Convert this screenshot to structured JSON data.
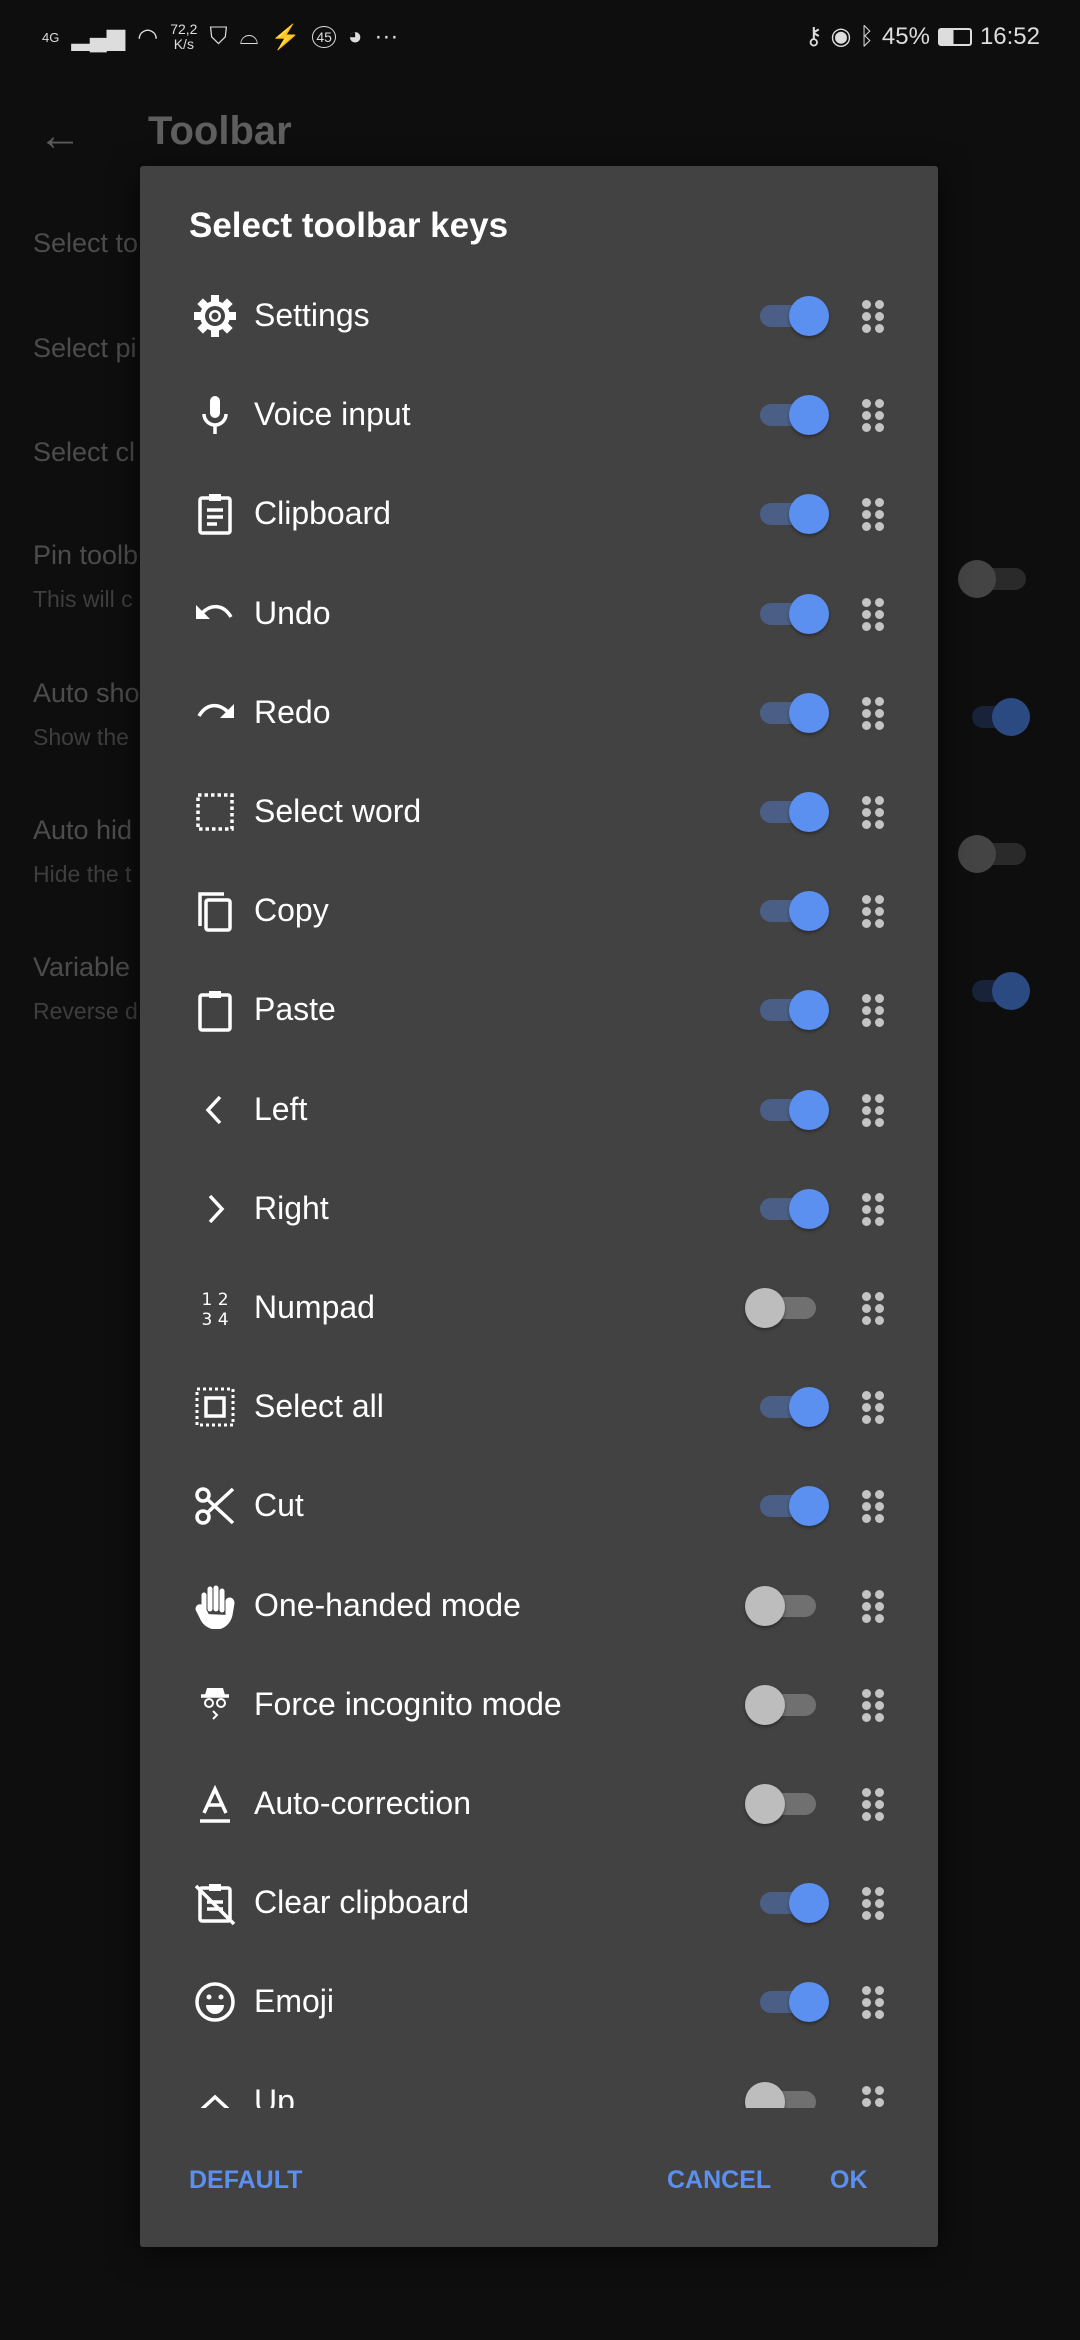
{
  "status_bar": {
    "network": "4G",
    "speed_value": "72,2",
    "speed_unit": "K/s",
    "notif_badge": "45",
    "battery": "45%",
    "time": "16:52"
  },
  "app_bar": {
    "title": "Toolbar"
  },
  "background_settings": [
    {
      "title": "Select to",
      "subtitle": ""
    },
    {
      "title": "Select pi",
      "subtitle": ""
    },
    {
      "title": "Select cl",
      "subtitle": ""
    },
    {
      "title": "Pin toolb",
      "subtitle": "This will c",
      "toggle": false
    },
    {
      "title": "Auto sho",
      "subtitle": "Show the",
      "toggle": true
    },
    {
      "title": "Auto hid",
      "subtitle": "Hide the t",
      "toggle": false
    },
    {
      "title": "Variable",
      "subtitle": "Reverse d",
      "toggle": true
    }
  ],
  "dialog": {
    "title": "Select toolbar keys",
    "items": [
      {
        "label": "Settings",
        "icon": "gear",
        "enabled": true
      },
      {
        "label": "Voice input",
        "icon": "microphone",
        "enabled": true
      },
      {
        "label": "Clipboard",
        "icon": "clipboard",
        "enabled": true
      },
      {
        "label": "Undo",
        "icon": "undo",
        "enabled": true
      },
      {
        "label": "Redo",
        "icon": "redo",
        "enabled": true
      },
      {
        "label": "Select word",
        "icon": "select-word",
        "enabled": true
      },
      {
        "label": "Copy",
        "icon": "copy",
        "enabled": true
      },
      {
        "label": "Paste",
        "icon": "paste",
        "enabled": true
      },
      {
        "label": "Left",
        "icon": "chevron-left",
        "enabled": true
      },
      {
        "label": "Right",
        "icon": "chevron-right",
        "enabled": true
      },
      {
        "label": "Numpad",
        "icon": "numpad",
        "enabled": false
      },
      {
        "label": "Select all",
        "icon": "select-all",
        "enabled": true
      },
      {
        "label": "Cut",
        "icon": "scissors",
        "enabled": true
      },
      {
        "label": "One-handed mode",
        "icon": "hand",
        "enabled": false
      },
      {
        "label": "Force incognito mode",
        "icon": "incognito",
        "enabled": false
      },
      {
        "label": "Auto-correction",
        "icon": "auto-correction",
        "enabled": false
      },
      {
        "label": "Clear clipboard",
        "icon": "clear-clipboard",
        "enabled": true
      },
      {
        "label": "Emoji",
        "icon": "emoji",
        "enabled": true
      },
      {
        "label": "Up",
        "icon": "chevron-up",
        "enabled": false
      }
    ],
    "buttons": {
      "default": "DEFAULT",
      "cancel": "CANCEL",
      "ok": "OK"
    }
  },
  "colors": {
    "accent": "#5b8ff0",
    "dialog_bg": "#424242",
    "background": "#0e0e0e"
  }
}
